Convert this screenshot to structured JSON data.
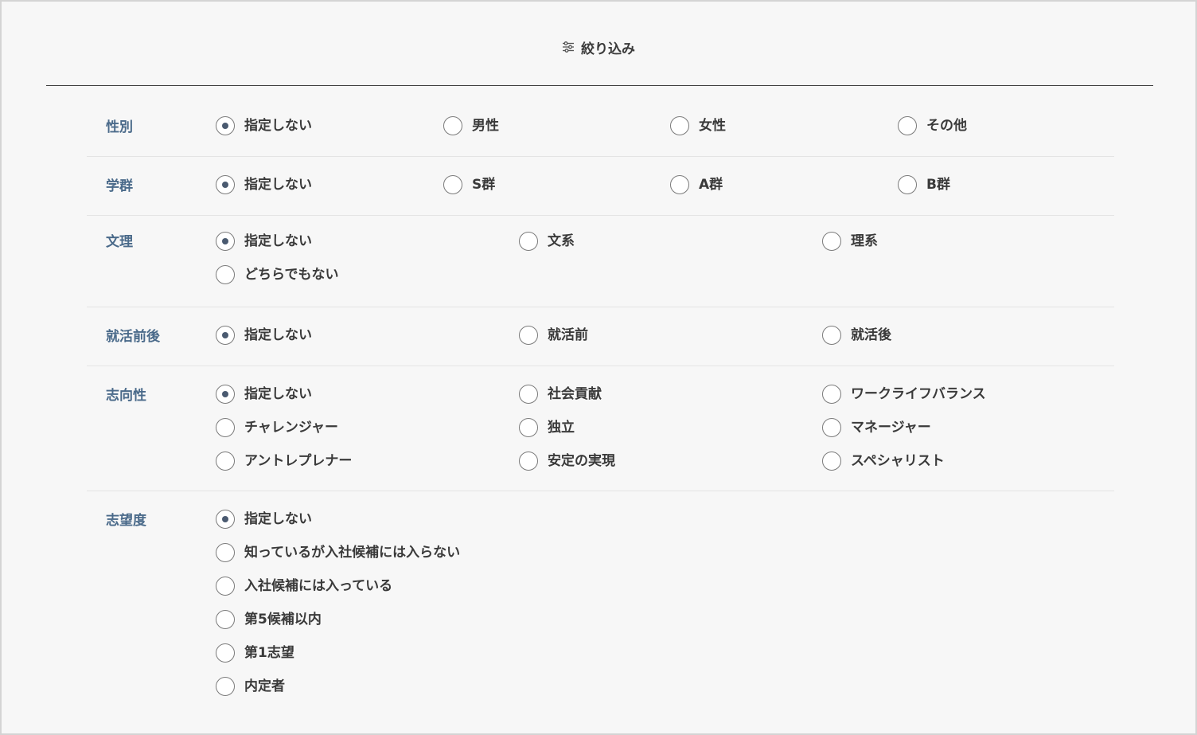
{
  "header": {
    "title": "絞り込み",
    "icon": "sliders-icon"
  },
  "rows": [
    {
      "label": "性別",
      "options": [
        {
          "label": "指定しない",
          "checked": true
        },
        {
          "label": "男性",
          "checked": false
        },
        {
          "label": "女性",
          "checked": false
        },
        {
          "label": "その他",
          "checked": false
        }
      ]
    },
    {
      "label": "学群",
      "options": [
        {
          "label": "指定しない",
          "checked": true
        },
        {
          "label": "S群",
          "checked": false
        },
        {
          "label": "A群",
          "checked": false
        },
        {
          "label": "B群",
          "checked": false
        }
      ]
    },
    {
      "label": "文理",
      "options": [
        {
          "label": "指定しない",
          "checked": true
        },
        {
          "label": "文系",
          "checked": false
        },
        {
          "label": "理系",
          "checked": false
        },
        {
          "label": "どちらでもない",
          "checked": false
        }
      ]
    },
    {
      "label": "就活前後",
      "options": [
        {
          "label": "指定しない",
          "checked": true
        },
        {
          "label": "就活前",
          "checked": false
        },
        {
          "label": "就活後",
          "checked": false
        }
      ]
    },
    {
      "label": "志向性",
      "options": [
        {
          "label": "指定しない",
          "checked": true
        },
        {
          "label": "社会貢献",
          "checked": false
        },
        {
          "label": "ワークライフバランス",
          "checked": false
        },
        {
          "label": "チャレンジャー",
          "checked": false
        },
        {
          "label": "独立",
          "checked": false
        },
        {
          "label": "マネージャー",
          "checked": false
        },
        {
          "label": "アントレプレナー",
          "checked": false
        },
        {
          "label": "安定の実現",
          "checked": false
        },
        {
          "label": "スペシャリスト",
          "checked": false
        }
      ]
    },
    {
      "label": "志望度",
      "options": [
        {
          "label": "指定しない",
          "checked": true
        },
        {
          "label": "知っているが入社候補には入らない",
          "checked": false
        },
        {
          "label": "入社候補には入っている",
          "checked": false
        },
        {
          "label": "第5候補以内",
          "checked": false
        },
        {
          "label": "第1志望",
          "checked": false
        },
        {
          "label": "内定者",
          "checked": false
        }
      ]
    }
  ]
}
